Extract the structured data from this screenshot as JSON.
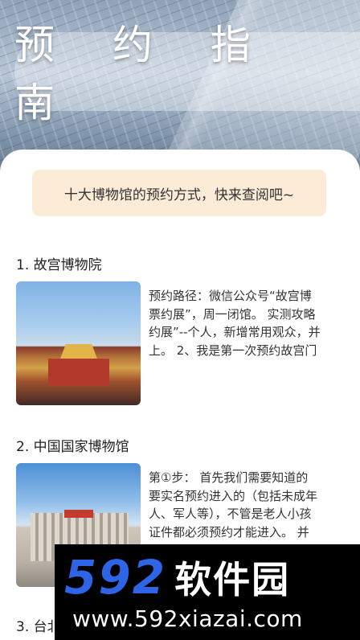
{
  "header": {
    "title": "预 约 指 南"
  },
  "banner": {
    "text": "十大博物馆的预约方式，快来查阅吧~"
  },
  "museums": [
    {
      "title": "1. 故宫博物院",
      "image": "forbidden-city-photo",
      "text": "预约路径：微信公众号“故宫博\n票约展”，周一闭馆。 实测攻略\n约展”--个人，新增常用观众，并\n上。 2、我是第一次预约故宫门"
    },
    {
      "title": "2. 中国国家博物馆",
      "image": "national-museum-photo",
      "text": "第①步： 首先我们需要知道的\n要实名预约进入的（包括未成年\n人、军人等），不管是老人小孩\n证件都必须预约才能进入。 并"
    },
    {
      "title": "3. 台北"
    }
  ],
  "watermark": {
    "logo_number": "592",
    "logo_text": "软件园",
    "url": "www.592xiazai.com"
  },
  "colors": {
    "banner_bg": "#fbebd7",
    "watermark_blue": "#2e64e6"
  }
}
